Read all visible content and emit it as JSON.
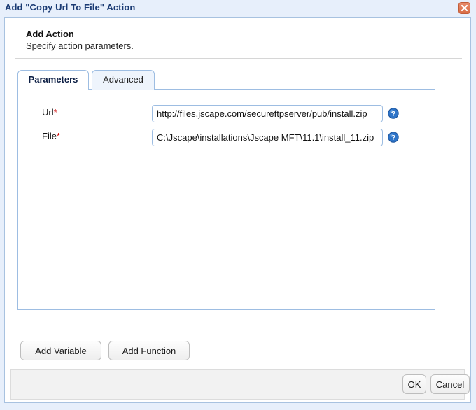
{
  "window": {
    "title": "Add \"Copy Url To File\" Action",
    "close_icon": "close-icon"
  },
  "header": {
    "title": "Add Action",
    "subtitle": "Specify action parameters."
  },
  "tabs": [
    {
      "label": "Parameters",
      "active": true
    },
    {
      "label": "Advanced",
      "active": false
    }
  ],
  "form": {
    "fields": [
      {
        "label": "Url",
        "required_marker": "*",
        "value": "http://files.jscape.com/secureftpserver/pub/install.zip",
        "placeholder": "",
        "help_icon": "help-icon"
      },
      {
        "label": "File",
        "required_marker": "*",
        "value": "C:\\Jscape\\installations\\Jscape MFT\\11.1\\install_11.zip",
        "placeholder": "",
        "help_icon": "help-icon"
      }
    ]
  },
  "buttons": {
    "add_variable": "Add Variable",
    "add_function": "Add Function",
    "ok": "OK",
    "cancel": "Cancel"
  },
  "colors": {
    "window_background": "#e7effb",
    "panel_background": "#ffffff",
    "title_text": "#1a3a73",
    "border_blue": "#9dbde2",
    "required_red": "#d00000",
    "help_blue": "#2e74c8",
    "close_orange": "#d96c45",
    "footer_gray": "#f2f2f2"
  }
}
